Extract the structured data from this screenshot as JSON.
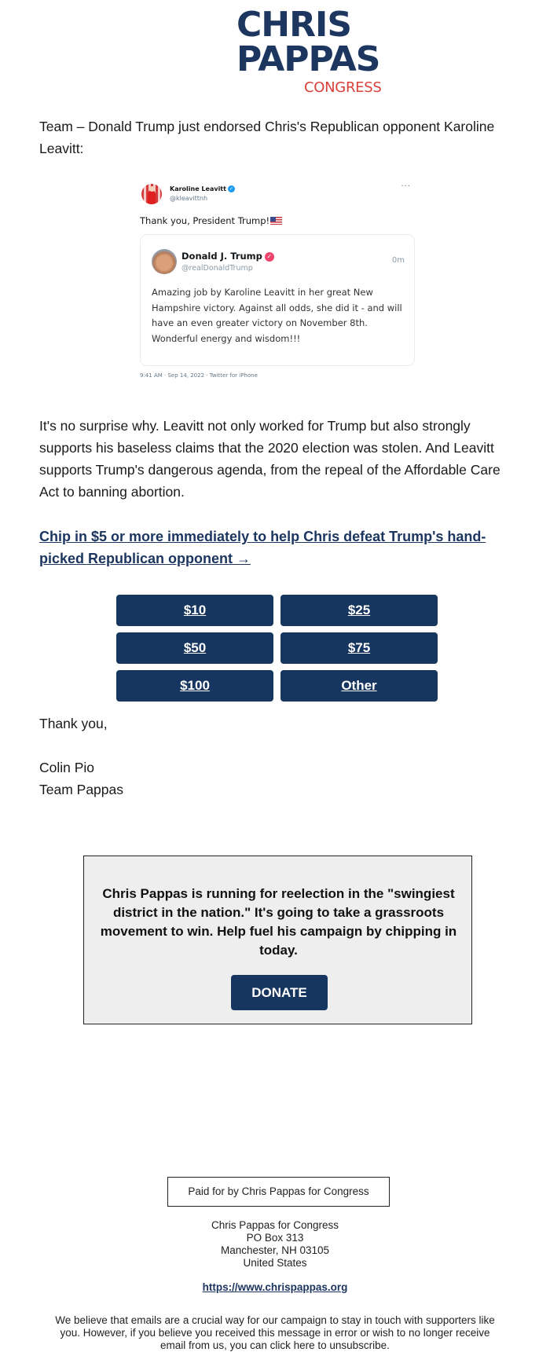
{
  "logo": {
    "line1": "CHRIS",
    "line2": "PAPPAS",
    "line3": "CONGRESS",
    "colors": {
      "primary": "#1d3660",
      "accent": "#d9403a"
    }
  },
  "intro_paragraph": "Team – Donald Trump just endorsed Chris's Republican opponent Karoline Leavitt:",
  "tweet": {
    "author_name": "Karoline Leavitt",
    "author_handle": "@kleavittnh",
    "author_verified_icon": "verified-badge-icon",
    "more_icon": "more-options-icon",
    "more_glyph": "···",
    "text": "Thank you, President Trump!",
    "flag_icon": "us-flag-icon",
    "quoted": {
      "author_name": "Donald J. Trump",
      "author_handle": "@realDonaldTrump",
      "time": "0m",
      "verified_icon": "verified-badge-icon",
      "body": "Amazing job by Karoline Leavitt in her great New Hampshire victory. Against all odds, she did it - and will have an even greater victory on November 8th. Wonderful energy and wisdom!!!"
    },
    "meta": "9:41 AM · Sep 14, 2022 · Twitter for iPhone"
  },
  "body_paragraph": "It's no surprise why. Leavitt not only worked for Trump but also strongly supports his baseless claims that the 2020 election was stolen. And Leavitt supports Trump's dangerous agenda, from the repeal of the Affordable Care Act to banning abortion.",
  "cta_link": "Chip in $5 or more immediately to help Chris defeat Trump's hand-picked Republican opponent →",
  "donation_amounts": [
    {
      "label": "$10"
    },
    {
      "label": "$25"
    },
    {
      "label": "$50"
    },
    {
      "label": "$75"
    },
    {
      "label": "$100"
    },
    {
      "label": "Other"
    }
  ],
  "signoff": {
    "closing": "Thank you,",
    "name": "Colin Pio",
    "team": "Team Pappas"
  },
  "promo": {
    "text": "Chris Pappas is running for reelection in the \"swingiest district in the nation.\" It's going to take a grassroots movement to win. Help fuel his campaign by chipping in today.",
    "button_label": "DONATE"
  },
  "footer": {
    "paid_for": "Paid for by Chris Pappas for Congress",
    "address_lines": [
      "Chris Pappas for Congress",
      "PO Box 313",
      "Manchester, NH 03105",
      "United States"
    ],
    "website": "https://www.chrispappas.org",
    "disclaimer": "We believe that emails are a crucial way for our campaign to stay in touch with supporters like you. However, if you believe you received this message in error or wish to no longer receive email from us, you can click here to unsubscribe."
  },
  "colors": {
    "button_bg": "#17365f",
    "link": "#1d3660",
    "promo_bg": "#eeeeee"
  }
}
